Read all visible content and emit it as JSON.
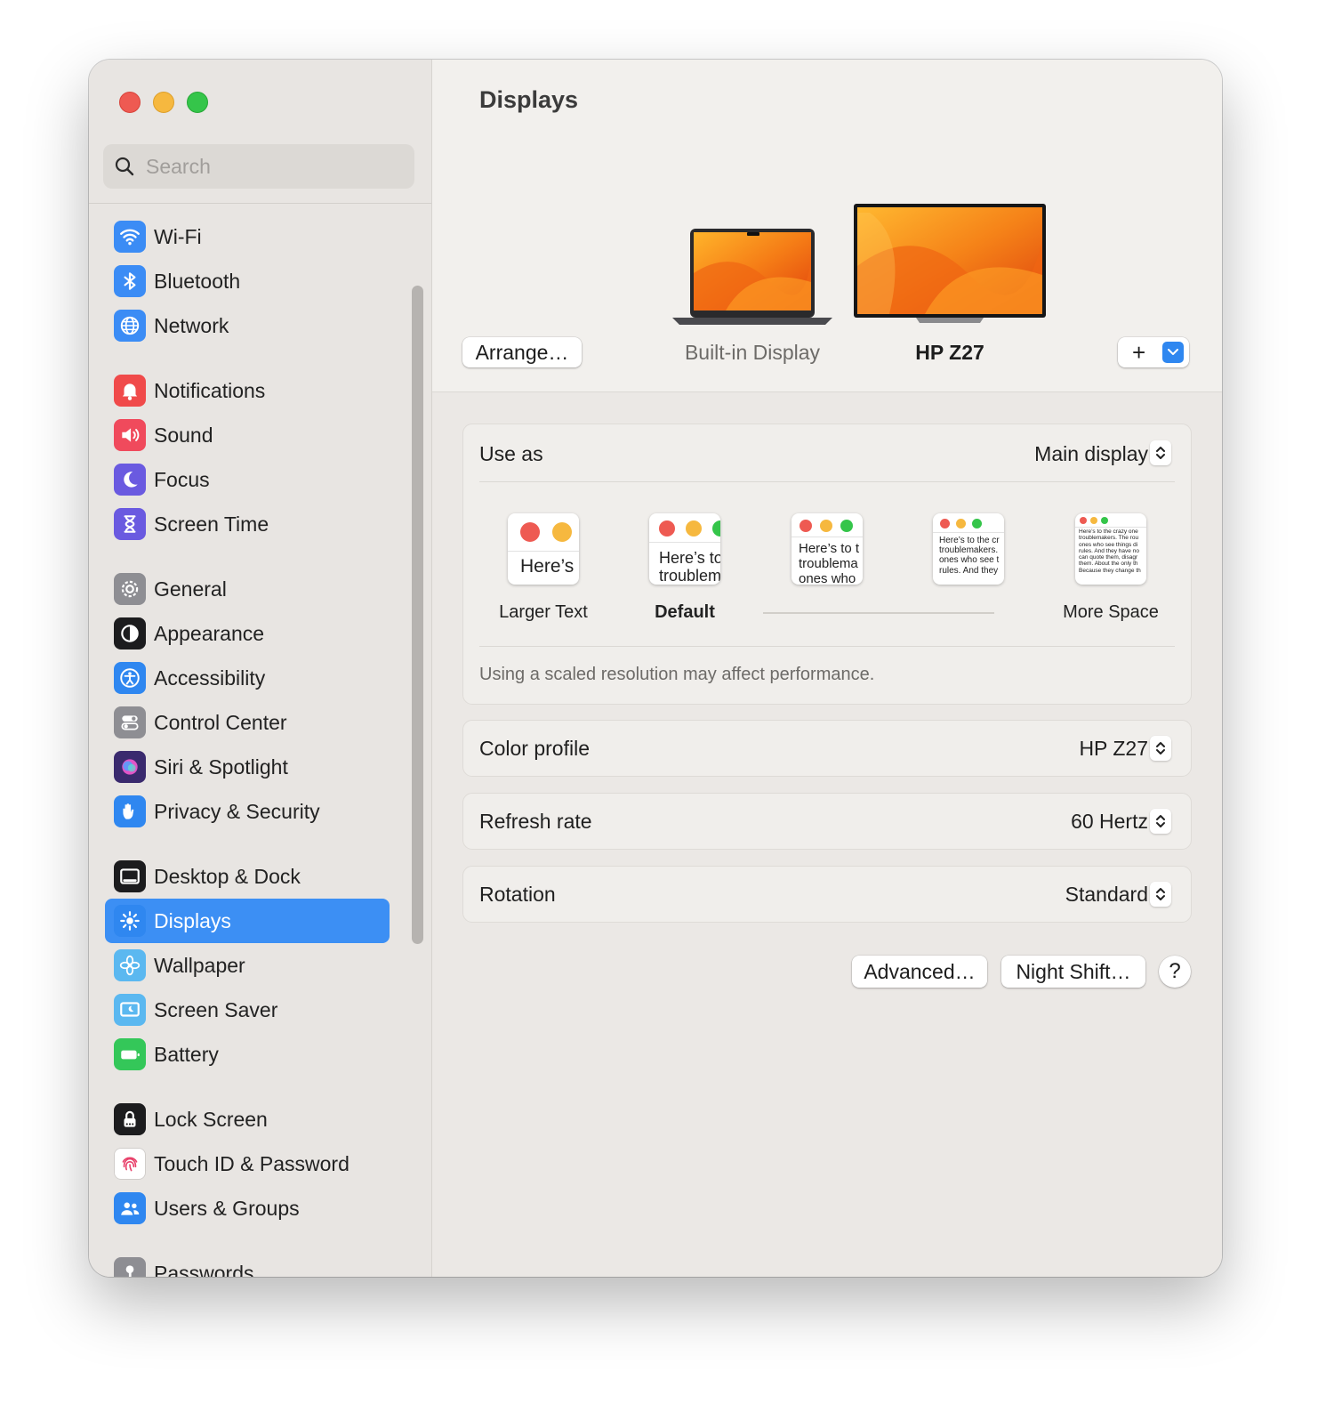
{
  "window": {
    "title": "Displays"
  },
  "search": {
    "placeholder": "Search"
  },
  "sidebar": {
    "groups": [
      [
        {
          "label": "Wi-Fi",
          "icon": "wifi-icon",
          "color": "#3b8cf5"
        },
        {
          "label": "Bluetooth",
          "icon": "bluetooth-icon",
          "color": "#3b8cf5"
        },
        {
          "label": "Network",
          "icon": "globe-icon",
          "color": "#3b8cf5"
        }
      ],
      [
        {
          "label": "Notifications",
          "icon": "bell-icon",
          "color": "#f04a4a"
        },
        {
          "label": "Sound",
          "icon": "speaker-icon",
          "color": "#f04a5c"
        },
        {
          "label": "Focus",
          "icon": "moon-icon",
          "color": "#6a5ae0"
        },
        {
          "label": "Screen Time",
          "icon": "hourglass-icon",
          "color": "#6a5ae0"
        }
      ],
      [
        {
          "label": "General",
          "icon": "gear-icon",
          "color": "#8e8e93"
        },
        {
          "label": "Appearance",
          "icon": "appearance-icon",
          "color": "#1c1c1e"
        },
        {
          "label": "Accessibility",
          "icon": "accessibility-icon",
          "color": "#2f87f0"
        },
        {
          "label": "Control Center",
          "icon": "toggles-icon",
          "color": "#8e8e93"
        },
        {
          "label": "Siri & Spotlight",
          "icon": "siri-icon",
          "color": "#3a2a6e"
        },
        {
          "label": "Privacy & Security",
          "icon": "hand-icon",
          "color": "#2f87f0"
        }
      ],
      [
        {
          "label": "Desktop & Dock",
          "icon": "dock-icon",
          "color": "#1c1c1e"
        },
        {
          "label": "Displays",
          "icon": "sun-icon",
          "color": "#2f87f0",
          "active": true
        },
        {
          "label": "Wallpaper",
          "icon": "flower-icon",
          "color": "#5bb8f0"
        },
        {
          "label": "Screen Saver",
          "icon": "screensaver-icon",
          "color": "#5bb8f0"
        },
        {
          "label": "Battery",
          "icon": "battery-icon",
          "color": "#34c759"
        }
      ],
      [
        {
          "label": "Lock Screen",
          "icon": "lock-icon",
          "color": "#1c1c1e"
        },
        {
          "label": "Touch ID & Password",
          "icon": "fingerprint-icon",
          "color": "#ffffff"
        },
        {
          "label": "Users & Groups",
          "icon": "users-icon",
          "color": "#2f87f0"
        }
      ],
      [
        {
          "label": "Passwords",
          "icon": "key-icon",
          "color": "#8e8e93"
        }
      ]
    ]
  },
  "displays": {
    "arrange_button": "Arrange…",
    "builtin_label": "Built-in Display",
    "external_label": "HP Z27",
    "add_button": "+"
  },
  "settings": {
    "use_as": {
      "label": "Use as",
      "value": "Main display"
    },
    "resolution": {
      "options": [
        {
          "label": "Larger Text",
          "sample": "Here’s"
        },
        {
          "label": "Default",
          "sample": "Here’s to\ntroublem"
        },
        {
          "label": "",
          "sample": "Here’s to t\ntroublema\nones who"
        },
        {
          "label": "",
          "sample": "Here’s to the cr\ntroublemakers.\nones who see t\nrules. And they"
        },
        {
          "label": "More Space",
          "sample": "Here’s to the crazy one\ntroublemakers. The rou\nones who see things di\nrules. And they have no\ncan quote them, disagr\nthem. About the only th\nBecause they change th"
        }
      ],
      "note": "Using a scaled resolution may affect performance."
    },
    "color_profile": {
      "label": "Color profile",
      "value": "HP Z27"
    },
    "refresh_rate": {
      "label": "Refresh rate",
      "value": "60 Hertz"
    },
    "rotation": {
      "label": "Rotation",
      "value": "Standard"
    }
  },
  "footer": {
    "advanced_button": "Advanced…",
    "night_shift_button": "Night Shift…",
    "help_button": "?"
  },
  "colors": {
    "accent": "#3c8ff4",
    "sidebar_bg": "#e8e5e2",
    "content_bg": "#ebe8e5"
  }
}
